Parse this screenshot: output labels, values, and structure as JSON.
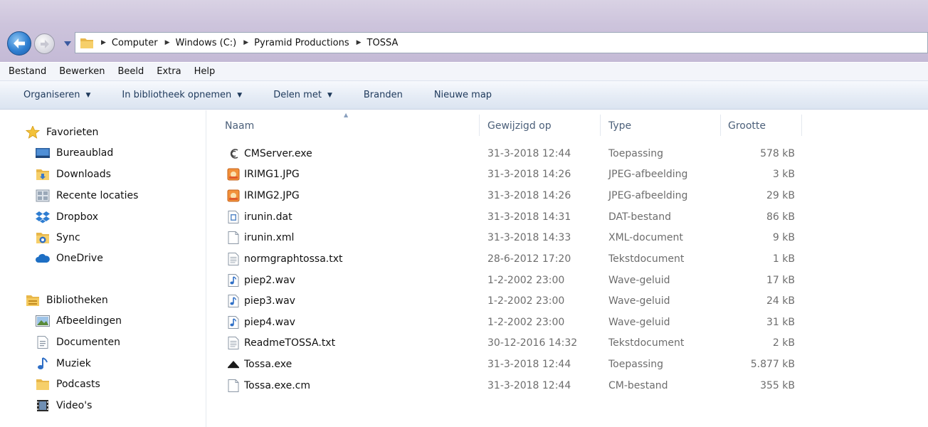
{
  "window": {
    "breadcrumb": [
      "Computer",
      "Windows (C:)",
      "Pyramid Productions",
      "TOSSA"
    ]
  },
  "menubar": [
    "Bestand",
    "Bewerken",
    "Beeld",
    "Extra",
    "Help"
  ],
  "toolbar": {
    "organize": "Organiseren",
    "include_library": "In bibliotheek opnemen",
    "share_with": "Delen met",
    "burn": "Branden",
    "new_folder": "Nieuwe map"
  },
  "navpane": {
    "favorites_label": "Favorieten",
    "favorites": [
      "Bureaublad",
      "Downloads",
      "Recente locaties",
      "Dropbox",
      "Sync",
      "OneDrive"
    ],
    "libraries_label": "Bibliotheken",
    "libraries": [
      "Afbeeldingen",
      "Documenten",
      "Muziek",
      "Podcasts",
      "Video's"
    ]
  },
  "columns": {
    "name": "Naam",
    "modified": "Gewijzigd op",
    "type": "Type",
    "size": "Grootte"
  },
  "files": [
    {
      "name": "CMServer.exe",
      "modified": "31-3-2018 12:44",
      "type": "Toepassing",
      "size": "578 kB",
      "icon": "cm-app-icon"
    },
    {
      "name": "IRIMG1.JPG",
      "modified": "31-3-2018 14:26",
      "type": "JPEG-afbeelding",
      "size": "3 kB",
      "icon": "jpeg-icon"
    },
    {
      "name": "IRIMG2.JPG",
      "modified": "31-3-2018 14:26",
      "type": "JPEG-afbeelding",
      "size": "29 kB",
      "icon": "jpeg-icon"
    },
    {
      "name": "irunin.dat",
      "modified": "31-3-2018 14:31",
      "type": "DAT-bestand",
      "size": "86 kB",
      "icon": "dat-file-icon"
    },
    {
      "name": "irunin.xml",
      "modified": "31-3-2018 14:33",
      "type": "XML-document",
      "size": "9 kB",
      "icon": "blank-file-icon"
    },
    {
      "name": "normgraphtossa.txt",
      "modified": "28-6-2012 17:20",
      "type": "Tekstdocument",
      "size": "1 kB",
      "icon": "text-file-icon"
    },
    {
      "name": "piep2.wav",
      "modified": "1-2-2002 23:00",
      "type": "Wave-geluid",
      "size": "17 kB",
      "icon": "audio-file-icon"
    },
    {
      "name": "piep3.wav",
      "modified": "1-2-2002 23:00",
      "type": "Wave-geluid",
      "size": "24 kB",
      "icon": "audio-file-icon"
    },
    {
      "name": "piep4.wav",
      "modified": "1-2-2002 23:00",
      "type": "Wave-geluid",
      "size": "31 kB",
      "icon": "audio-file-icon"
    },
    {
      "name": "ReadmeTOSSA.txt",
      "modified": "30-12-2016 14:32",
      "type": "Tekstdocument",
      "size": "2 kB",
      "icon": "text-file-icon"
    },
    {
      "name": "Tossa.exe",
      "modified": "31-3-2018 12:44",
      "type": "Toepassing",
      "size": "5.877 kB",
      "icon": "tossa-app-icon"
    },
    {
      "name": "Tossa.exe.cm",
      "modified": "31-3-2018 12:44",
      "type": "CM-bestand",
      "size": "355 kB",
      "icon": "blank-file-icon"
    }
  ]
}
